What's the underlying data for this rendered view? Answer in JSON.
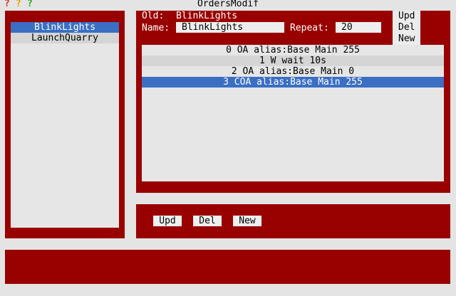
{
  "help_marks": [
    {
      "text": "?",
      "color": "#e03020"
    },
    {
      "text": "?",
      "color": "#e0a000"
    },
    {
      "text": "?",
      "color": "#20b020"
    }
  ],
  "window": {
    "title": "OrdersModif"
  },
  "programs": {
    "items": [
      "BlinkLights",
      "LaunchQuarry"
    ],
    "selected": "BlinkLights"
  },
  "editor": {
    "old_label": "Old:",
    "old_value": "BlinkLights",
    "name_label": "Name:",
    "name_value": "BlinkLights",
    "repeat_label": "Repeat:",
    "repeat_value": "20",
    "side_buttons": {
      "upd": "Upd",
      "del": "Del",
      "new": "New"
    }
  },
  "orders": {
    "items": [
      "0 OA alias:Base Main 255",
      "1 W wait 10s",
      "2 OA alias:Base Main 0",
      "3 COA alias:Base Main 255"
    ],
    "selected_index": 3
  },
  "bottom_buttons": {
    "upd": "Upd",
    "del": "Del",
    "new": "New"
  },
  "colors": {
    "panel": "#990000",
    "selection": "#3a6fc4"
  }
}
